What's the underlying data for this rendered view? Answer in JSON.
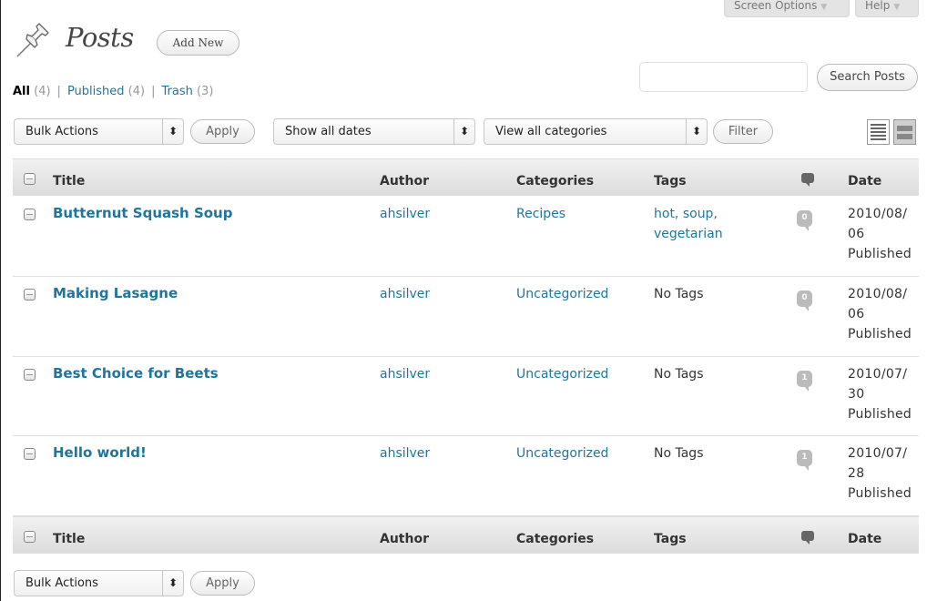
{
  "header": {
    "title": "Posts",
    "add_new_label": "Add New",
    "screen_options_label": "Screen Options",
    "help_label": "Help",
    "icon": "pushpin-icon"
  },
  "views": {
    "all_label": "All",
    "all_count": "(4)",
    "published_label": "Published",
    "published_count": "(4)",
    "trash_label": "Trash",
    "trash_count": "(3)",
    "separator": "|"
  },
  "search": {
    "placeholder": "",
    "value": "",
    "button_label": "Search Posts"
  },
  "filters": {
    "bulk_actions_label": "Bulk Actions",
    "apply_label": "Apply",
    "dates_label": "Show all dates",
    "categories_label": "View all categories",
    "filter_label": "Filter",
    "select_arrow": "⬍"
  },
  "table": {
    "columns": {
      "title": "Title",
      "author": "Author",
      "categories": "Categories",
      "tags": "Tags",
      "comments_icon": "comment-bubble-icon",
      "date": "Date"
    },
    "rows": [
      {
        "title": "Butternut Squash Soup",
        "author": "ahsilver",
        "category": "Recipes",
        "tags_line1": "hot, soup,",
        "tags_line2": "vegetarian",
        "comments": "0",
        "date_line1": "2010/08/",
        "date_line2": "06",
        "status": "Published"
      },
      {
        "title": "Making Lasagne",
        "author": "ahsilver",
        "category": "Uncategorized",
        "tags_line1": "No Tags",
        "tags_line2": "",
        "comments": "0",
        "date_line1": "2010/08/",
        "date_line2": "06",
        "status": "Published"
      },
      {
        "title": "Best Choice for Beets",
        "author": "ahsilver",
        "category": "Uncategorized",
        "tags_line1": "No Tags",
        "tags_line2": "",
        "comments": "1",
        "date_line1": "2010/07/",
        "date_line2": "30",
        "status": "Published"
      },
      {
        "title": "Hello world!",
        "author": "ahsilver",
        "category": "Uncategorized",
        "tags_line1": "No Tags",
        "tags_line2": "",
        "comments": "1",
        "date_line1": "2010/07/",
        "date_line2": "28",
        "status": "Published"
      }
    ]
  },
  "colors": {
    "link": "#21759b",
    "header_bg": "#dcdcdc",
    "comment_bubble": "#bbbbbb"
  }
}
